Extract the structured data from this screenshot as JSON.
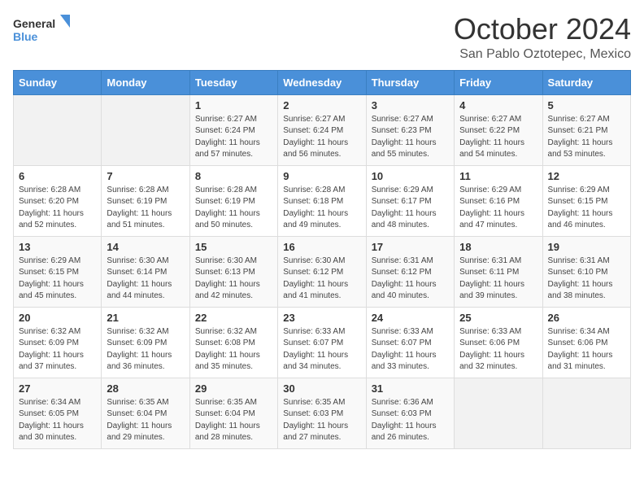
{
  "header": {
    "logo_line1": "General",
    "logo_line2": "Blue",
    "month_title": "October 2024",
    "location": "San Pablo Oztotepec, Mexico"
  },
  "days_of_week": [
    "Sunday",
    "Monday",
    "Tuesday",
    "Wednesday",
    "Thursday",
    "Friday",
    "Saturday"
  ],
  "weeks": [
    [
      {
        "day": "",
        "info": ""
      },
      {
        "day": "",
        "info": ""
      },
      {
        "day": "1",
        "info": "Sunrise: 6:27 AM\nSunset: 6:24 PM\nDaylight: 11 hours and 57 minutes."
      },
      {
        "day": "2",
        "info": "Sunrise: 6:27 AM\nSunset: 6:24 PM\nDaylight: 11 hours and 56 minutes."
      },
      {
        "day": "3",
        "info": "Sunrise: 6:27 AM\nSunset: 6:23 PM\nDaylight: 11 hours and 55 minutes."
      },
      {
        "day": "4",
        "info": "Sunrise: 6:27 AM\nSunset: 6:22 PM\nDaylight: 11 hours and 54 minutes."
      },
      {
        "day": "5",
        "info": "Sunrise: 6:27 AM\nSunset: 6:21 PM\nDaylight: 11 hours and 53 minutes."
      }
    ],
    [
      {
        "day": "6",
        "info": "Sunrise: 6:28 AM\nSunset: 6:20 PM\nDaylight: 11 hours and 52 minutes."
      },
      {
        "day": "7",
        "info": "Sunrise: 6:28 AM\nSunset: 6:19 PM\nDaylight: 11 hours and 51 minutes."
      },
      {
        "day": "8",
        "info": "Sunrise: 6:28 AM\nSunset: 6:19 PM\nDaylight: 11 hours and 50 minutes."
      },
      {
        "day": "9",
        "info": "Sunrise: 6:28 AM\nSunset: 6:18 PM\nDaylight: 11 hours and 49 minutes."
      },
      {
        "day": "10",
        "info": "Sunrise: 6:29 AM\nSunset: 6:17 PM\nDaylight: 11 hours and 48 minutes."
      },
      {
        "day": "11",
        "info": "Sunrise: 6:29 AM\nSunset: 6:16 PM\nDaylight: 11 hours and 47 minutes."
      },
      {
        "day": "12",
        "info": "Sunrise: 6:29 AM\nSunset: 6:15 PM\nDaylight: 11 hours and 46 minutes."
      }
    ],
    [
      {
        "day": "13",
        "info": "Sunrise: 6:29 AM\nSunset: 6:15 PM\nDaylight: 11 hours and 45 minutes."
      },
      {
        "day": "14",
        "info": "Sunrise: 6:30 AM\nSunset: 6:14 PM\nDaylight: 11 hours and 44 minutes."
      },
      {
        "day": "15",
        "info": "Sunrise: 6:30 AM\nSunset: 6:13 PM\nDaylight: 11 hours and 42 minutes."
      },
      {
        "day": "16",
        "info": "Sunrise: 6:30 AM\nSunset: 6:12 PM\nDaylight: 11 hours and 41 minutes."
      },
      {
        "day": "17",
        "info": "Sunrise: 6:31 AM\nSunset: 6:12 PM\nDaylight: 11 hours and 40 minutes."
      },
      {
        "day": "18",
        "info": "Sunrise: 6:31 AM\nSunset: 6:11 PM\nDaylight: 11 hours and 39 minutes."
      },
      {
        "day": "19",
        "info": "Sunrise: 6:31 AM\nSunset: 6:10 PM\nDaylight: 11 hours and 38 minutes."
      }
    ],
    [
      {
        "day": "20",
        "info": "Sunrise: 6:32 AM\nSunset: 6:09 PM\nDaylight: 11 hours and 37 minutes."
      },
      {
        "day": "21",
        "info": "Sunrise: 6:32 AM\nSunset: 6:09 PM\nDaylight: 11 hours and 36 minutes."
      },
      {
        "day": "22",
        "info": "Sunrise: 6:32 AM\nSunset: 6:08 PM\nDaylight: 11 hours and 35 minutes."
      },
      {
        "day": "23",
        "info": "Sunrise: 6:33 AM\nSunset: 6:07 PM\nDaylight: 11 hours and 34 minutes."
      },
      {
        "day": "24",
        "info": "Sunrise: 6:33 AM\nSunset: 6:07 PM\nDaylight: 11 hours and 33 minutes."
      },
      {
        "day": "25",
        "info": "Sunrise: 6:33 AM\nSunset: 6:06 PM\nDaylight: 11 hours and 32 minutes."
      },
      {
        "day": "26",
        "info": "Sunrise: 6:34 AM\nSunset: 6:06 PM\nDaylight: 11 hours and 31 minutes."
      }
    ],
    [
      {
        "day": "27",
        "info": "Sunrise: 6:34 AM\nSunset: 6:05 PM\nDaylight: 11 hours and 30 minutes."
      },
      {
        "day": "28",
        "info": "Sunrise: 6:35 AM\nSunset: 6:04 PM\nDaylight: 11 hours and 29 minutes."
      },
      {
        "day": "29",
        "info": "Sunrise: 6:35 AM\nSunset: 6:04 PM\nDaylight: 11 hours and 28 minutes."
      },
      {
        "day": "30",
        "info": "Sunrise: 6:35 AM\nSunset: 6:03 PM\nDaylight: 11 hours and 27 minutes."
      },
      {
        "day": "31",
        "info": "Sunrise: 6:36 AM\nSunset: 6:03 PM\nDaylight: 11 hours and 26 minutes."
      },
      {
        "day": "",
        "info": ""
      },
      {
        "day": "",
        "info": ""
      }
    ]
  ]
}
